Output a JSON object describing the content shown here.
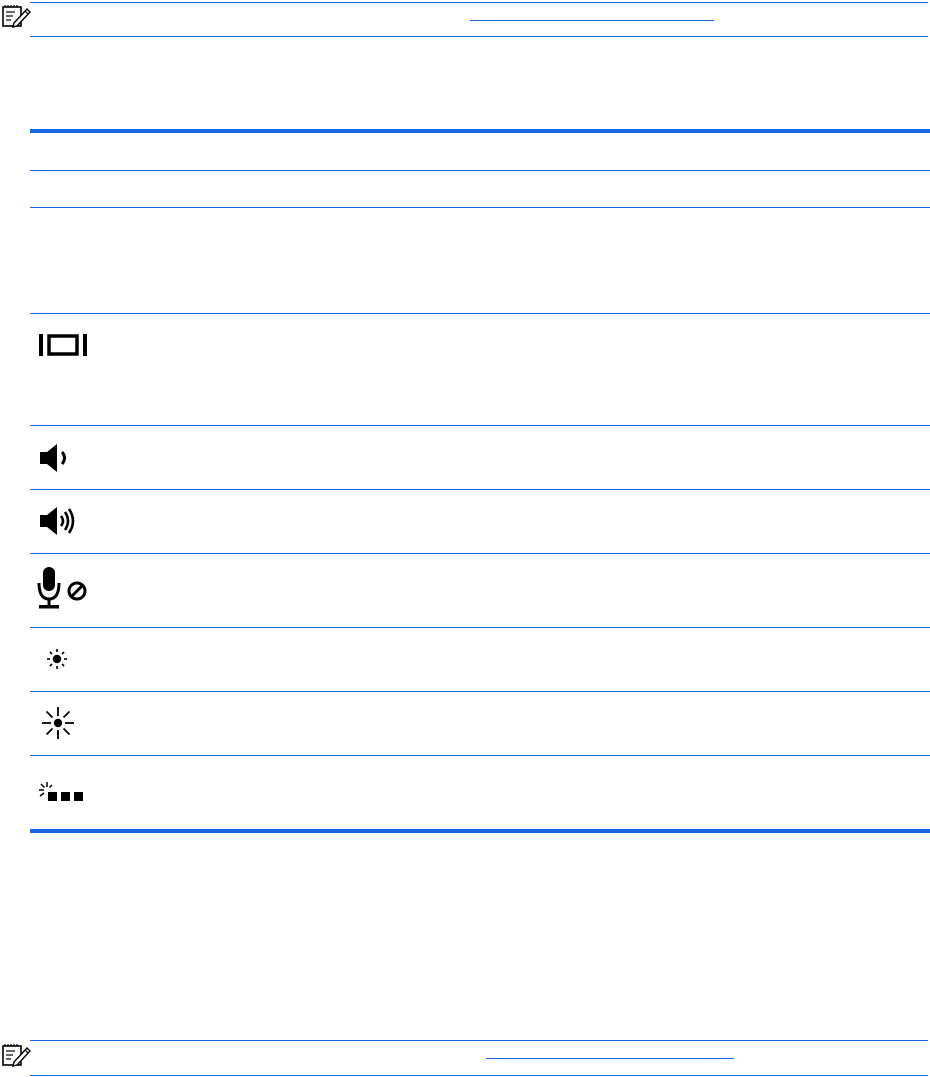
{
  "notes": [
    {
      "icon": "note-pencil-icon",
      "link_text": ""
    },
    {
      "icon": "note-pencil-icon",
      "link_text": ""
    }
  ],
  "action_keys_table": {
    "header_row": [],
    "rows": [
      {
        "icon": "sleep-moon-icon",
        "description": ""
      },
      {
        "icon": "switch-screen-image-icon",
        "description": ""
      },
      {
        "icon": "volume-down-icon",
        "description": ""
      },
      {
        "icon": "volume-up-icon",
        "description": ""
      },
      {
        "icon": "microphone-mute-icon",
        "description": ""
      },
      {
        "icon": "brightness-down-icon",
        "description": ""
      },
      {
        "icon": "brightness-up-icon",
        "description": ""
      },
      {
        "icon": "keyboard-backlight-icon",
        "description": ""
      }
    ]
  },
  "colors": {
    "accent": "#1a66e0",
    "icon": "#000000"
  }
}
